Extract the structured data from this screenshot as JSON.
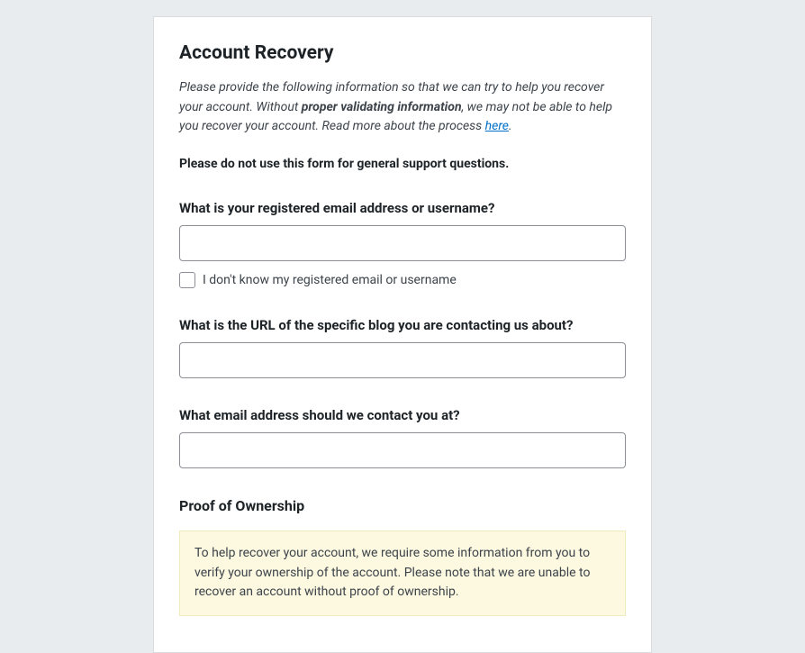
{
  "title": "Account Recovery",
  "intro": {
    "part1": "Please provide the following information so that we can try to help you recover your account. Without ",
    "strong": "proper validating information",
    "part2": ", we may not be able to help you recover your account. Read more about the process ",
    "link_text": "here",
    "part3": "."
  },
  "warning": "Please do not use this form for general support questions.",
  "fields": {
    "email_username": {
      "label": "What is your registered email address or username?",
      "value": ""
    },
    "dont_know": {
      "label": "I don't know my registered email or username"
    },
    "blog_url": {
      "label": "What is the URL of the specific blog you are contacting us about?",
      "value": ""
    },
    "contact_email": {
      "label": "What email address should we contact you at?",
      "value": ""
    }
  },
  "proof": {
    "heading": "Proof of Ownership",
    "notice": "To help recover your account, we require some information from you to verify your ownership of the account. Please note that we are unable to recover an account without proof of ownership."
  }
}
